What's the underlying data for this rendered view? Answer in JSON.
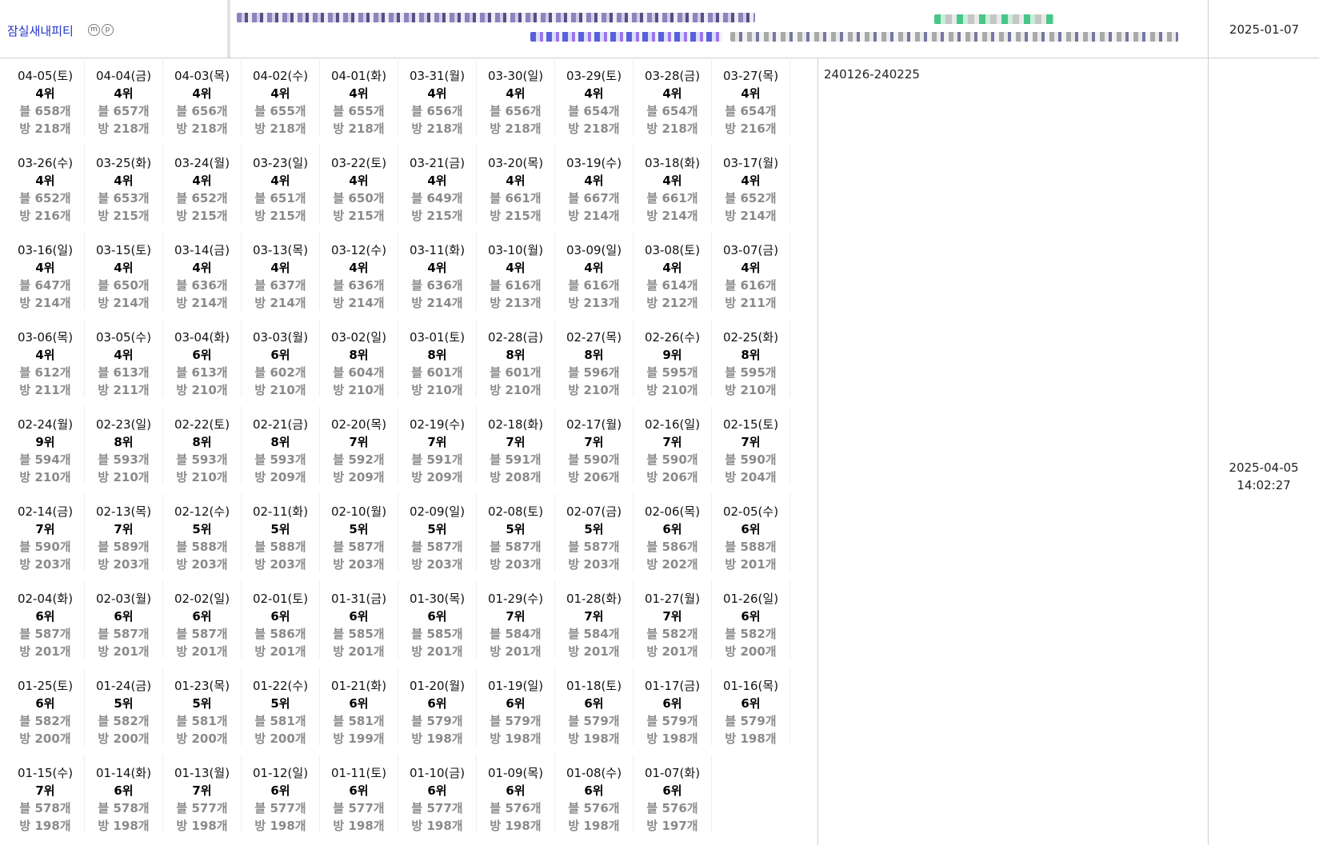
{
  "header": {
    "place_name": "잠실새내피티",
    "badge_m": "m",
    "badge_p": "p",
    "date": "2025-01-07"
  },
  "side": {
    "range": "240126-240225",
    "stamp_date": "2025-04-05",
    "stamp_time": "14:02:27"
  },
  "rows": [
    [
      [
        "04-05(토)",
        "4위",
        "블 658개",
        "방 218개"
      ],
      [
        "04-04(금)",
        "4위",
        "블 657개",
        "방 218개"
      ],
      [
        "04-03(목)",
        "4위",
        "블 656개",
        "방 218개"
      ],
      [
        "04-02(수)",
        "4위",
        "블 655개",
        "방 218개"
      ],
      [
        "04-01(화)",
        "4위",
        "블 655개",
        "방 218개"
      ],
      [
        "03-31(월)",
        "4위",
        "블 656개",
        "방 218개"
      ],
      [
        "03-30(일)",
        "4위",
        "블 656개",
        "방 218개"
      ],
      [
        "03-29(토)",
        "4위",
        "블 654개",
        "방 218개"
      ],
      [
        "03-28(금)",
        "4위",
        "블 654개",
        "방 218개"
      ],
      [
        "03-27(목)",
        "4위",
        "블 654개",
        "방 216개"
      ]
    ],
    [
      [
        "03-26(수)",
        "4위",
        "블 652개",
        "방 216개"
      ],
      [
        "03-25(화)",
        "4위",
        "블 653개",
        "방 215개"
      ],
      [
        "03-24(월)",
        "4위",
        "블 652개",
        "방 215개"
      ],
      [
        "03-23(일)",
        "4위",
        "블 651개",
        "방 215개"
      ],
      [
        "03-22(토)",
        "4위",
        "블 650개",
        "방 215개"
      ],
      [
        "03-21(금)",
        "4위",
        "블 649개",
        "방 215개"
      ],
      [
        "03-20(목)",
        "4위",
        "블 661개",
        "방 215개"
      ],
      [
        "03-19(수)",
        "4위",
        "블 667개",
        "방 214개"
      ],
      [
        "03-18(화)",
        "4위",
        "블 661개",
        "방 214개"
      ],
      [
        "03-17(월)",
        "4위",
        "블 652개",
        "방 214개"
      ]
    ],
    [
      [
        "03-16(일)",
        "4위",
        "블 647개",
        "방 214개"
      ],
      [
        "03-15(토)",
        "4위",
        "블 650개",
        "방 214개"
      ],
      [
        "03-14(금)",
        "4위",
        "블 636개",
        "방 214개"
      ],
      [
        "03-13(목)",
        "4위",
        "블 637개",
        "방 214개"
      ],
      [
        "03-12(수)",
        "4위",
        "블 636개",
        "방 214개"
      ],
      [
        "03-11(화)",
        "4위",
        "블 636개",
        "방 214개"
      ],
      [
        "03-10(월)",
        "4위",
        "블 616개",
        "방 213개"
      ],
      [
        "03-09(일)",
        "4위",
        "블 616개",
        "방 213개"
      ],
      [
        "03-08(토)",
        "4위",
        "블 614개",
        "방 212개"
      ],
      [
        "03-07(금)",
        "4위",
        "블 616개",
        "방 211개"
      ]
    ],
    [
      [
        "03-06(목)",
        "4위",
        "블 612개",
        "방 211개"
      ],
      [
        "03-05(수)",
        "4위",
        "블 613개",
        "방 211개"
      ],
      [
        "03-04(화)",
        "6위",
        "블 613개",
        "방 210개"
      ],
      [
        "03-03(월)",
        "6위",
        "블 602개",
        "방 210개"
      ],
      [
        "03-02(일)",
        "8위",
        "블 604개",
        "방 210개"
      ],
      [
        "03-01(토)",
        "8위",
        "블 601개",
        "방 210개"
      ],
      [
        "02-28(금)",
        "8위",
        "블 601개",
        "방 210개"
      ],
      [
        "02-27(목)",
        "8위",
        "블 596개",
        "방 210개"
      ],
      [
        "02-26(수)",
        "9위",
        "블 595개",
        "방 210개"
      ],
      [
        "02-25(화)",
        "8위",
        "블 595개",
        "방 210개"
      ]
    ],
    [
      [
        "02-24(월)",
        "9위",
        "블 594개",
        "방 210개"
      ],
      [
        "02-23(일)",
        "8위",
        "블 593개",
        "방 210개"
      ],
      [
        "02-22(토)",
        "8위",
        "블 593개",
        "방 210개"
      ],
      [
        "02-21(금)",
        "8위",
        "블 593개",
        "방 209개"
      ],
      [
        "02-20(목)",
        "7위",
        "블 592개",
        "방 209개"
      ],
      [
        "02-19(수)",
        "7위",
        "블 591개",
        "방 209개"
      ],
      [
        "02-18(화)",
        "7위",
        "블 591개",
        "방 208개"
      ],
      [
        "02-17(월)",
        "7위",
        "블 590개",
        "방 206개"
      ],
      [
        "02-16(일)",
        "7위",
        "블 590개",
        "방 206개"
      ],
      [
        "02-15(토)",
        "7위",
        "블 590개",
        "방 204개"
      ]
    ],
    [
      [
        "02-14(금)",
        "7위",
        "블 590개",
        "방 203개"
      ],
      [
        "02-13(목)",
        "7위",
        "블 589개",
        "방 203개"
      ],
      [
        "02-12(수)",
        "5위",
        "블 588개",
        "방 203개"
      ],
      [
        "02-11(화)",
        "5위",
        "블 588개",
        "방 203개"
      ],
      [
        "02-10(월)",
        "5위",
        "블 587개",
        "방 203개"
      ],
      [
        "02-09(일)",
        "5위",
        "블 587개",
        "방 203개"
      ],
      [
        "02-08(토)",
        "5위",
        "블 587개",
        "방 203개"
      ],
      [
        "02-07(금)",
        "5위",
        "블 587개",
        "방 203개"
      ],
      [
        "02-06(목)",
        "6위",
        "블 586개",
        "방 202개"
      ],
      [
        "02-05(수)",
        "6위",
        "블 588개",
        "방 201개"
      ]
    ],
    [
      [
        "02-04(화)",
        "6위",
        "블 587개",
        "방 201개"
      ],
      [
        "02-03(월)",
        "6위",
        "블 587개",
        "방 201개"
      ],
      [
        "02-02(일)",
        "6위",
        "블 587개",
        "방 201개"
      ],
      [
        "02-01(토)",
        "6위",
        "블 586개",
        "방 201개"
      ],
      [
        "01-31(금)",
        "6위",
        "블 585개",
        "방 201개"
      ],
      [
        "01-30(목)",
        "6위",
        "블 585개",
        "방 201개"
      ],
      [
        "01-29(수)",
        "7위",
        "블 584개",
        "방 201개"
      ],
      [
        "01-28(화)",
        "7위",
        "블 584개",
        "방 201개"
      ],
      [
        "01-27(월)",
        "7위",
        "블 582개",
        "방 201개"
      ],
      [
        "01-26(일)",
        "6위",
        "블 582개",
        "방 200개"
      ]
    ],
    [
      [
        "01-25(토)",
        "6위",
        "블 582개",
        "방 200개"
      ],
      [
        "01-24(금)",
        "5위",
        "블 582개",
        "방 200개"
      ],
      [
        "01-23(목)",
        "5위",
        "블 581개",
        "방 200개"
      ],
      [
        "01-22(수)",
        "5위",
        "블 581개",
        "방 200개"
      ],
      [
        "01-21(화)",
        "6위",
        "블 581개",
        "방 199개"
      ],
      [
        "01-20(월)",
        "6위",
        "블 579개",
        "방 198개"
      ],
      [
        "01-19(일)",
        "6위",
        "블 579개",
        "방 198개"
      ],
      [
        "01-18(토)",
        "6위",
        "블 579개",
        "방 198개"
      ],
      [
        "01-17(금)",
        "6위",
        "블 579개",
        "방 198개"
      ],
      [
        "01-16(목)",
        "6위",
        "블 579개",
        "방 198개"
      ]
    ],
    [
      [
        "01-15(수)",
        "7위",
        "블 578개",
        "방 198개"
      ],
      [
        "01-14(화)",
        "6위",
        "블 578개",
        "방 198개"
      ],
      [
        "01-13(월)",
        "7위",
        "블 577개",
        "방 198개"
      ],
      [
        "01-12(일)",
        "6위",
        "블 577개",
        "방 198개"
      ],
      [
        "01-11(토)",
        "6위",
        "블 577개",
        "방 198개"
      ],
      [
        "01-10(금)",
        "6위",
        "블 577개",
        "방 198개"
      ],
      [
        "01-09(목)",
        "6위",
        "블 576개",
        "방 198개"
      ],
      [
        "01-08(수)",
        "6위",
        "블 576개",
        "방 198개"
      ],
      [
        "01-07(화)",
        "6위",
        "블 576개",
        "방 197개"
      ]
    ]
  ]
}
